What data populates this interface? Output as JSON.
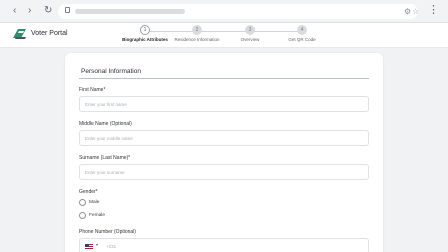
{
  "browser": {
    "back_icon": "arrow-left-icon",
    "forward_icon": "arrow-right-icon",
    "reload_icon": "reload-icon"
  },
  "app": {
    "brand": "Voter Portal"
  },
  "stepper": {
    "steps": [
      {
        "number": "1",
        "label": "Biographic Attributes",
        "active": true
      },
      {
        "number": "2",
        "label": "Residence Information",
        "active": false
      },
      {
        "number": "3",
        "label": "Overview",
        "active": false
      },
      {
        "number": "4",
        "label": "Get QR Code",
        "active": false
      }
    ]
  },
  "form": {
    "section_title": "Personal Information",
    "first_name": {
      "label": "First Name*",
      "placeholder": "Enter your first name"
    },
    "middle_name": {
      "label": "Middle Name (Optional)",
      "placeholder": "Enter your middle name"
    },
    "surname": {
      "label": "Surname (Last Name)*",
      "placeholder": "Enter your surname"
    },
    "gender": {
      "label": "Gender*",
      "options": [
        "Male",
        "Female"
      ]
    },
    "phone": {
      "label": "Phone Number (Optional)",
      "dial_code": "+231"
    }
  },
  "colors": {
    "page_bg": "#f1f2f4",
    "card_bg": "#ffffff",
    "accent_rule": "#b9c3cc"
  }
}
